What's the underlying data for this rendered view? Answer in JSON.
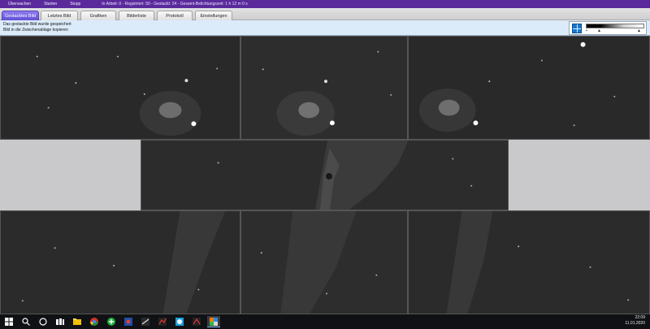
{
  "topbar": {
    "commands": [
      "Überwachen",
      "Starten",
      "Stopp"
    ],
    "status": "In Arbeit: 0 - Registriert: 50 - Gestackt: 24 - Gesamt-Belichtungszeit: 1 h 12 m 0 s"
  },
  "tabs": [
    {
      "label": "Gestacktes Bild",
      "active": true
    },
    {
      "label": "Letztes Bild",
      "active": false
    },
    {
      "label": "Grafiken",
      "active": false
    },
    {
      "label": "Bilderliste",
      "active": false
    },
    {
      "label": "Protokoll",
      "active": false
    },
    {
      "label": "Einstellungen",
      "active": false
    }
  ],
  "messages": {
    "line1": "Das gestackte Bild wurde gespeichert",
    "line2": "Bild in die Zwischenablage kopieren"
  },
  "taskbar": {
    "time": "22:09",
    "date": "11.01.2020"
  },
  "colors": {
    "topbar": "#5a2a9c",
    "active_tab": "#6a58dd",
    "message_panel": "#dcebfa",
    "taskbar": "#101114"
  }
}
